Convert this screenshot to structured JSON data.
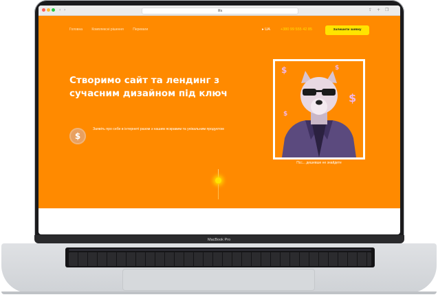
{
  "browser": {
    "url_text": "lifa",
    "colors": {
      "close": "#ff5f57",
      "minimize": "#febc2e",
      "maximize": "#28c840"
    }
  },
  "site": {
    "background": "#ff8a00",
    "accent": "#ffe400",
    "nav": [
      "Головна",
      "Комплексні рішення",
      "Переваги"
    ],
    "lang": "UA",
    "phone": "+380 99 555 42 85",
    "cta_label": "Залишити заявку",
    "headline_first_letter": "С",
    "headline_rest": "творимо сайт та лендинг з сучасним дизайном під ключ",
    "description": "Заявіть про себе в інтернеті разом з нашим яскравим та унікальним продуктом",
    "coin_symbol": "$",
    "dollar_symbol": "$",
    "caption": "Псс... дешевше не знайдете"
  },
  "laptop": {
    "brand": "MacBook Pro"
  }
}
